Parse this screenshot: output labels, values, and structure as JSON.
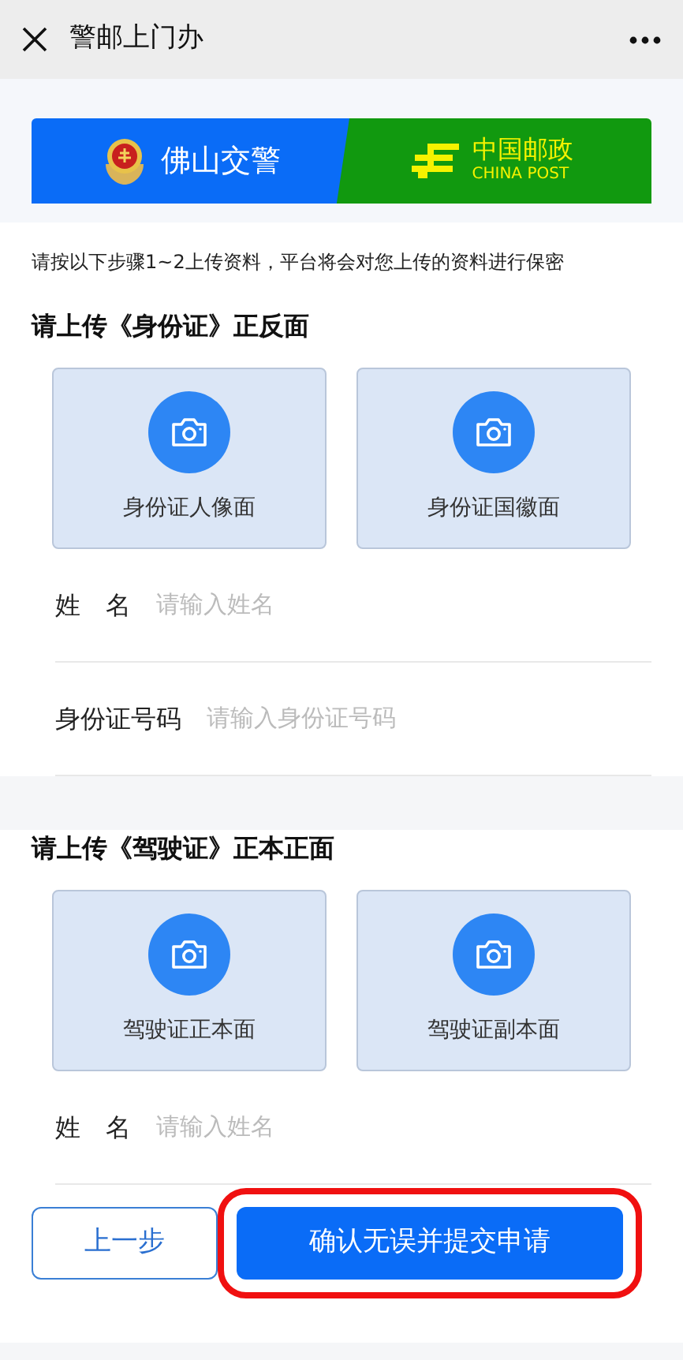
{
  "top_bar": {
    "title": "警邮上门办"
  },
  "banner": {
    "left_text": "佛山交警",
    "right_text": "中国邮政",
    "right_subtext": "CHINA POST"
  },
  "notice": "请按以下步骤1~2上传资料，平台将会对您上传的资料进行保密",
  "sections": [
    {
      "heading": "请上传《身份证》正反面",
      "uploads": [
        "身份证人像面",
        "身份证国徽面"
      ],
      "fields": [
        {
          "label": "姓　名",
          "placeholder": "请输入姓名"
        },
        {
          "label": "身份证号码",
          "placeholder": "请输入身份证号码"
        }
      ]
    },
    {
      "heading": "请上传《驾驶证》正本正面",
      "uploads": [
        "驾驶证正本面",
        "驾驶证副本面"
      ],
      "fields": [
        {
          "label": "姓　名",
          "placeholder": "请输入姓名"
        }
      ]
    }
  ],
  "buttons": [
    {
      "label": "上一步",
      "kind": "outline",
      "highlighted": false
    },
    {
      "label": "确认无误并提交申请",
      "kind": "primary",
      "highlighted": true
    }
  ]
}
